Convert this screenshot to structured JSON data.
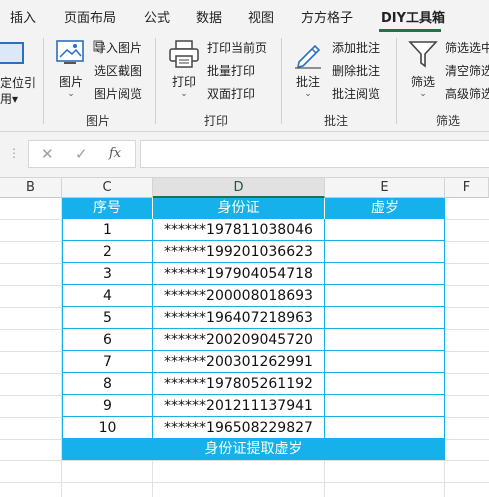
{
  "tabs": [
    {
      "label": "插入",
      "active": false
    },
    {
      "label": "页面布局",
      "active": false
    },
    {
      "label": "公式",
      "active": false
    },
    {
      "label": "数据",
      "active": false
    },
    {
      "label": "视图",
      "active": false
    },
    {
      "label": "方方格子",
      "active": false
    },
    {
      "label": "DIY工具箱",
      "active": true
    }
  ],
  "ribbon": {
    "left_fragment": {
      "line1": "定位引",
      "line2": "用▾"
    },
    "image_group": {
      "big_label": "图片",
      "items": [
        "导入图片",
        "选区截图",
        "图片阅览"
      ],
      "group_label": "图片"
    },
    "print_group": {
      "big_label": "打印",
      "items": [
        "打印当前页",
        "批量打印",
        "双面打印"
      ],
      "group_label": "打印"
    },
    "comment_group": {
      "big_label": "批注",
      "items": [
        "添加批注",
        "删除批注",
        "批注阅览"
      ],
      "group_label": "批注"
    },
    "filter_group": {
      "big_label": "筛选",
      "items": [
        "筛选选中",
        "清空筛选",
        "高级筛选"
      ],
      "group_label": "筛选"
    }
  },
  "formula_bar": {
    "cancel_glyph": "✕",
    "confirm_glyph": "✓",
    "fx_label": "fx",
    "value": ""
  },
  "columns": [
    "B",
    "C",
    "D",
    "E",
    "F"
  ],
  "table": {
    "headers": [
      "序号",
      "身份证",
      "虚岁"
    ],
    "rows": [
      [
        "1",
        "******197811038046",
        ""
      ],
      [
        "2",
        "******199201036623",
        ""
      ],
      [
        "3",
        "******197904054718",
        ""
      ],
      [
        "4",
        "******200008018693",
        ""
      ],
      [
        "5",
        "******196407218963",
        ""
      ],
      [
        "6",
        "******200209045720",
        ""
      ],
      [
        "7",
        "******200301262991",
        ""
      ],
      [
        "8",
        "******197805261192",
        ""
      ],
      [
        "9",
        "******201211137941",
        ""
      ],
      [
        "10",
        "******196508229827",
        ""
      ]
    ],
    "footer": "身份证提取虚岁"
  },
  "colors": {
    "accent": "#16b1ea",
    "excel_green": "#217346"
  }
}
